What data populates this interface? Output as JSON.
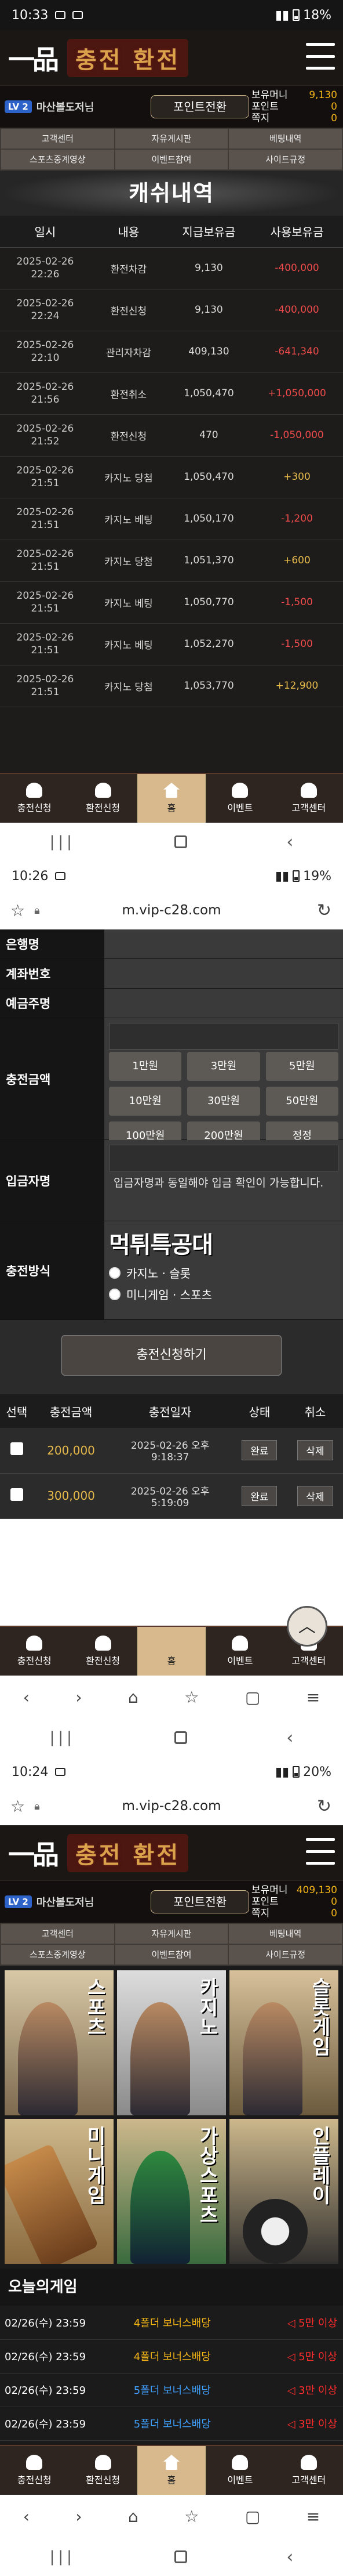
{
  "shot1": {
    "status": {
      "time": "10:33",
      "battery": "18%"
    },
    "header": {
      "logo": "一品",
      "title": "충전 환전"
    },
    "user": {
      "level": "LV 2",
      "name": "마산볼도저",
      "name_suffix": "님",
      "point_btn": "포인트전환",
      "money_label": "보유머니",
      "money": "9,130",
      "point_label": "포인트",
      "point": "0",
      "note_label": "쪽지",
      "note": "0"
    },
    "nav": [
      "고객센터",
      "자유게시판",
      "베팅내역",
      "스포츠중계영상",
      "이벤트참여",
      "사이트규정"
    ],
    "cash_title": "캐쉬내역",
    "cash_headers": [
      "일시",
      "내용",
      "지급보유금",
      "사용보유금"
    ],
    "cash_rows": [
      {
        "date": "2025-02-26",
        "time": "22:26",
        "desc": "환전차감",
        "bal": "9,130",
        "amt": "-400,000",
        "sign": "neg"
      },
      {
        "date": "2025-02-26",
        "time": "22:24",
        "desc": "환전신청",
        "bal": "9,130",
        "amt": "-400,000",
        "sign": "neg"
      },
      {
        "date": "2025-02-26",
        "time": "22:10",
        "desc": "관리자차감",
        "bal": "409,130",
        "amt": "-641,340",
        "sign": "neg"
      },
      {
        "date": "2025-02-26",
        "time": "21:56",
        "desc": "환전취소",
        "bal": "1,050,470",
        "amt": "+1,050,000",
        "sign": "neg"
      },
      {
        "date": "2025-02-26",
        "time": "21:52",
        "desc": "환전신청",
        "bal": "470",
        "amt": "-1,050,000",
        "sign": "neg"
      },
      {
        "date": "2025-02-26",
        "time": "21:51",
        "desc": "카지노 당첨",
        "bal": "1,050,470",
        "amt": "+300",
        "sign": "pos"
      },
      {
        "date": "2025-02-26",
        "time": "21:51",
        "desc": "카지노 베팅",
        "bal": "1,050,170",
        "amt": "-1,200",
        "sign": "neg"
      },
      {
        "date": "2025-02-26",
        "time": "21:51",
        "desc": "카지노 당첨",
        "bal": "1,051,370",
        "amt": "+600",
        "sign": "pos"
      },
      {
        "date": "2025-02-26",
        "time": "21:51",
        "desc": "카지노 베팅",
        "bal": "1,050,770",
        "amt": "-1,500",
        "sign": "neg"
      },
      {
        "date": "2025-02-26",
        "time": "21:51",
        "desc": "카지노 베팅",
        "bal": "1,052,270",
        "amt": "-1,500",
        "sign": "neg"
      },
      {
        "date": "2025-02-26",
        "time": "21:51",
        "desc": "카지노 당첨",
        "bal": "1,053,770",
        "amt": "+12,900",
        "sign": "pos"
      }
    ],
    "bottom_nav": [
      "충전신청",
      "환전신청",
      "홈",
      "이벤트",
      "고객센터"
    ]
  },
  "shot2": {
    "status": {
      "time": "10:26",
      "battery": "19%"
    },
    "url": "m.vip-c28.com",
    "labels": {
      "bank": "은행명",
      "account": "계좌번호",
      "holder": "예금주명",
      "amount": "충전금액",
      "depositor": "입금자명",
      "method": "충전방식"
    },
    "amounts": [
      "1만원",
      "3만원",
      "5만원",
      "10만원",
      "30만원",
      "50만원",
      "100만원",
      "200만원",
      "정정"
    ],
    "notice": "입금자명과 동일해야 입금 확인이 가능합니다.",
    "sticker": "먹튀특공대",
    "methods": [
      "카지노 · 슬롯",
      "미니게임 · 스포츠"
    ],
    "apply_btn": "충전신청하기",
    "hist_headers": [
      "선택",
      "충전금액",
      "충전일자",
      "상태",
      "취소"
    ],
    "hist_rows": [
      {
        "amount": "200,000",
        "date": "2025-02-26 오후",
        "time": "9:18:37",
        "status": "완료",
        "cancel": "삭제"
      },
      {
        "amount": "300,000",
        "date": "2025-02-26 오후",
        "time": "5:19:09",
        "status": "완료",
        "cancel": "삭제"
      }
    ],
    "bottom_nav": [
      "충전신청",
      "환전신청",
      "홈",
      "이벤트",
      "고객센터"
    ]
  },
  "shot3": {
    "status": {
      "time": "10:24",
      "battery": "20%"
    },
    "url": "m.vip-c28.com",
    "header": {
      "logo": "一品",
      "title": "충전 환전"
    },
    "user": {
      "level": "LV 2",
      "name": "마산볼도저",
      "name_suffix": "님",
      "point_btn": "포인트전환",
      "money_label": "보유머니",
      "money": "409,130",
      "point_label": "포인트",
      "point": "0",
      "note_label": "쪽지",
      "note": "0"
    },
    "nav": [
      "고객센터",
      "자유게시판",
      "베팅내역",
      "스포츠중계영상",
      "이벤트참여",
      "사이트규정"
    ],
    "games": [
      "스포츠",
      "카지노",
      "슬롯게임",
      "미니게임",
      "가상스포츠",
      "인플레이"
    ],
    "today_title": "오늘의게임",
    "today_rows": [
      {
        "date": "02/26(수) 23:59",
        "event": "4폴더 보너스배당",
        "badge": "5만 이상",
        "color": "#f2b417"
      },
      {
        "date": "02/26(수) 23:59",
        "event": "4폴더 보너스배당",
        "badge": "5만 이상",
        "color": "#f2b417"
      },
      {
        "date": "02/26(수) 23:59",
        "event": "5폴더 보너스배당",
        "badge": "3만 이상",
        "color": "#3fa0ff"
      },
      {
        "date": "02/26(수) 23:59",
        "event": "5폴더 보너스배당",
        "badge": "3만 이상",
        "color": "#3fa0ff"
      }
    ],
    "bottom_nav": [
      "충전신청",
      "환전신청",
      "홈",
      "이벤트",
      "고객센터"
    ]
  }
}
